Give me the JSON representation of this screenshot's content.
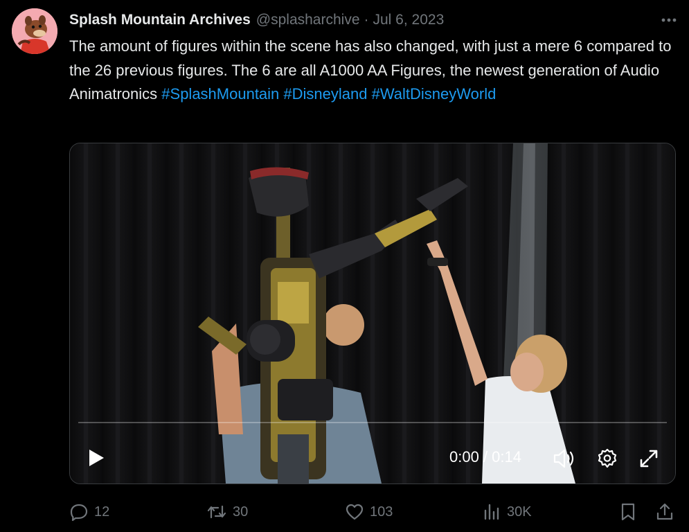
{
  "tweet": {
    "author_name": "Splash Mountain Archives",
    "handle": "@splasharchive",
    "separator": "·",
    "date": "Jul 6, 2023",
    "text_plain": "The amount of figures within the scene has also changed, with just a mere 6 compared to the 26 previous figures. The 6 are all A1000 AA Figures, the newest generation of Audio Animatronics ",
    "hashtags": [
      "#SplashMountain",
      "#Disneyland",
      "#WaltDisneyWorld"
    ]
  },
  "video": {
    "current_time": "0:00",
    "duration": "0:14",
    "time_separator": " / ",
    "progress": 0
  },
  "actions": {
    "replies": "12",
    "reposts": "30",
    "likes": "103",
    "views": "30K"
  },
  "icons": {
    "more": "more-icon",
    "play": "play-icon",
    "volume": "volume-icon",
    "settings": "gear-icon",
    "fullscreen": "fullscreen-icon",
    "reply": "reply-icon",
    "repost": "repost-icon",
    "like": "heart-icon",
    "views": "views-icon",
    "bookmark": "bookmark-icon",
    "share": "share-icon"
  },
  "colors": {
    "background": "#000000",
    "text": "#e7e9ea",
    "muted": "#71767b",
    "link": "#1d9bf0"
  }
}
